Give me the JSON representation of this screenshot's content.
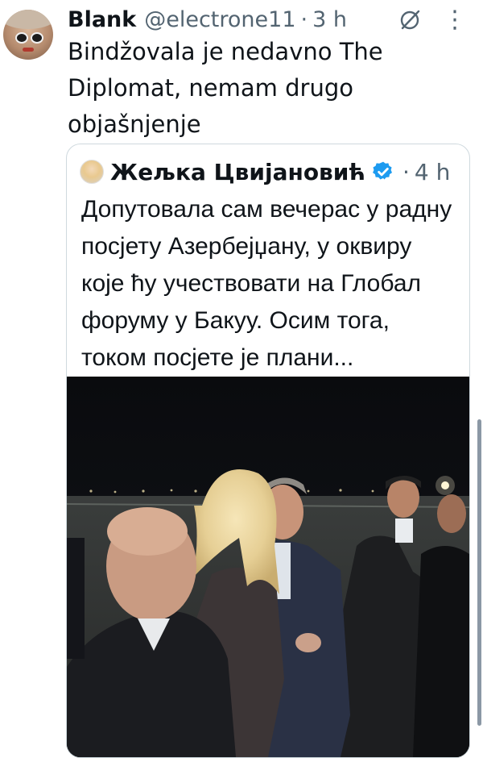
{
  "tweet": {
    "display_name": "Blank",
    "handle": "@electrone11",
    "separator": "·",
    "time": "3 h",
    "text": "Bindžovala je nedavno The Diplomat, nemam drugo objašnjenje",
    "icons": {
      "grok": "grok-icon",
      "more": "more-icon"
    }
  },
  "quote": {
    "display_name": "Жељка Цвијановић",
    "verified": true,
    "separator": "·",
    "time": "4 h",
    "text": "Допутовала сам вечерас у радну посјету Азербејџану, у оквиру које ћу учествовати на Глобал форуму у Бакуу. Осим тога, током посјете је плани..."
  },
  "colors": {
    "text_primary": "#0f1419",
    "text_secondary": "#536471",
    "verified_blue": "#1d9bf0",
    "border": "#cfd9de"
  }
}
